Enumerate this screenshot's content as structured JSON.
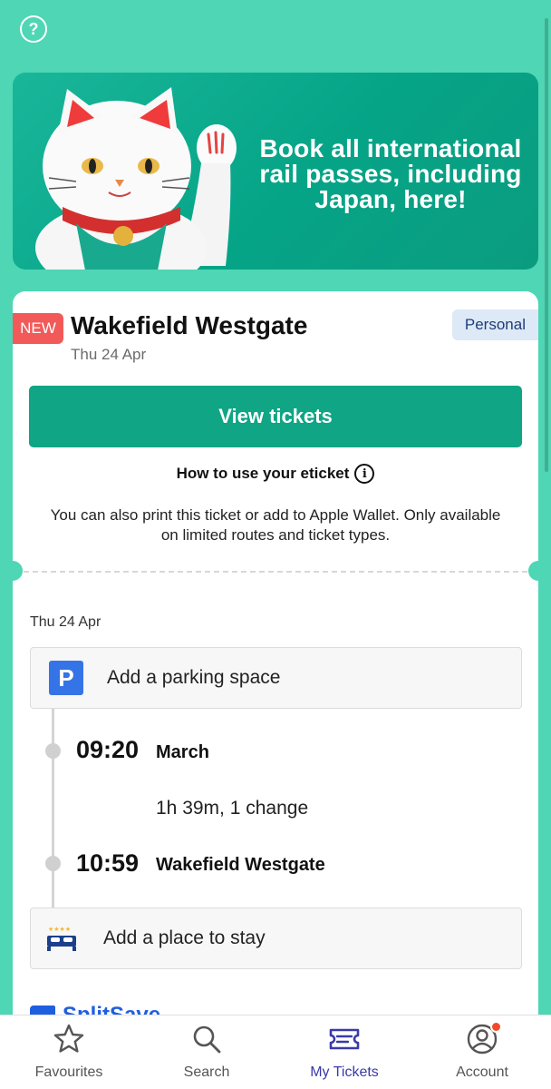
{
  "header": {
    "help_icon": "question-circle-icon"
  },
  "promo": {
    "text": "Book all international rail passes, including Japan, here!",
    "image": "lucky-cat-icon"
  },
  "ticket": {
    "badge": "NEW",
    "destination": "Wakefield Westgate",
    "date": "Thu 24 Apr",
    "type_badge": "Personal",
    "view_button": "View tickets",
    "howto_label": "How to use your eticket",
    "print_note": "You can also print this ticket or add to Apple Wallet. Only available on limited routes and ticket types."
  },
  "journey": {
    "date": "Thu 24 Apr",
    "parking_label": "Add a parking space",
    "departure": {
      "time": "09:20",
      "station": "March"
    },
    "duration": "1h 39m, 1 change",
    "arrival": {
      "time": "10:59",
      "station": "Wakefield Westgate"
    },
    "stay_label": "Add a place to stay",
    "splitsave_label": "SplitSave"
  },
  "tabs": [
    {
      "label": "Favourites",
      "icon": "star-icon",
      "active": false
    },
    {
      "label": "Search",
      "icon": "search-icon",
      "active": false
    },
    {
      "label": "My Tickets",
      "icon": "ticket-icon",
      "active": true
    },
    {
      "label": "Account",
      "icon": "account-icon",
      "active": false
    }
  ],
  "colors": {
    "background": "#4fd6b4",
    "primary_button": "#0fa585",
    "new_badge": "#f25a5a",
    "active_tab": "#3a3aa8"
  }
}
